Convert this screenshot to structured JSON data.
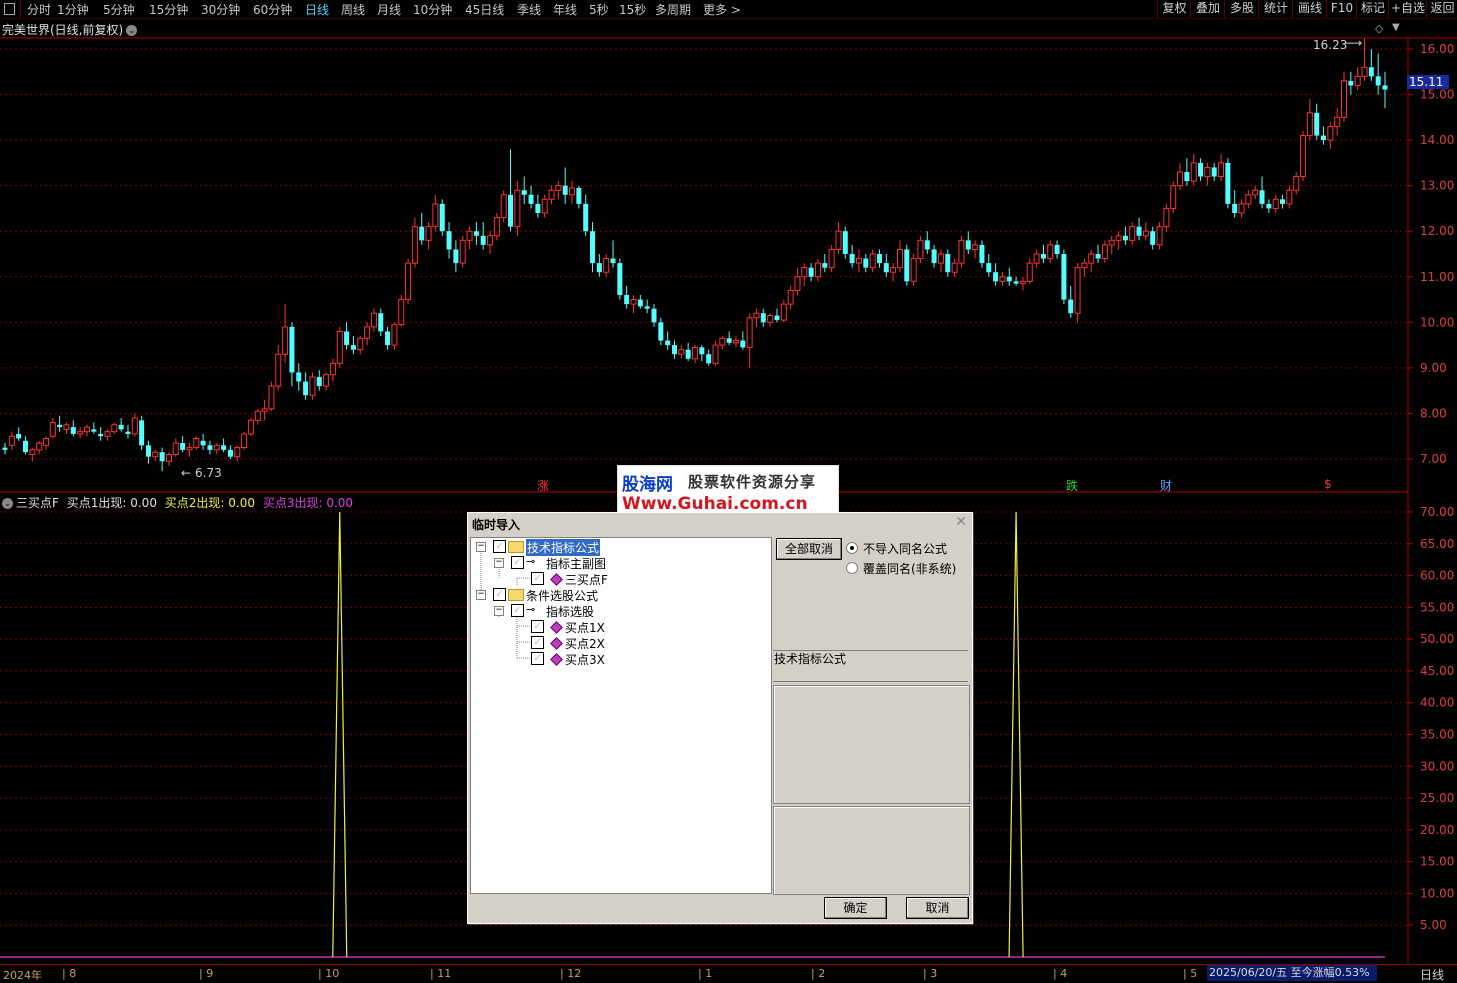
{
  "toolbar": {
    "periods": [
      "分时",
      "1分钟",
      "5分钟",
      "15分钟",
      "30分钟",
      "60分钟",
      "日线",
      "周线",
      "月线",
      "10分钟",
      "45日线",
      "季线",
      "年线",
      "5秒",
      "15秒",
      "多周期",
      "更多 >"
    ],
    "active_period": "日线",
    "right_buttons": [
      "复权",
      "叠加",
      "多股",
      "统计",
      "画线",
      "F10",
      "标记",
      "+自选",
      "返回"
    ]
  },
  "chart_title": "完美世界(日线,前复权)",
  "price_labels": {
    "high": "16.23",
    "low": "6.73",
    "current": "15.11"
  },
  "price_axis": [
    "16.00",
    "15.00",
    "14.00",
    "13.00",
    "12.00",
    "11.00",
    "10.00",
    "9.00",
    "8.00",
    "7.00"
  ],
  "markers": {
    "zhang": "涨",
    "die": "跌",
    "cai": "财",
    "dollar": "$"
  },
  "indicator": {
    "name": "三买点F",
    "b1_label": "买点1出现: ",
    "b1_value": "0.00",
    "b2_label": "买点2出现: ",
    "b2_value": "0.00",
    "b3_label": "买点3出现: ",
    "b3_value": "0.00",
    "axis": [
      "70.00",
      "65.00",
      "60.00",
      "55.00",
      "50.00",
      "45.00",
      "40.00",
      "35.00",
      "30.00",
      "25.00",
      "20.00",
      "15.00",
      "10.00",
      "5.00"
    ]
  },
  "watermark": {
    "name": "股海网",
    "slogan": "股票软件资源分享",
    "url": "Www.Guhai.com.cn"
  },
  "dialog": {
    "title": "临时导入",
    "tree": [
      {
        "label": "技术指标公式"
      },
      {
        "label": "指标主副图"
      },
      {
        "label": "三买点F"
      },
      {
        "label": "条件选股公式"
      },
      {
        "label": "指标选股"
      },
      {
        "label": "买点1X"
      },
      {
        "label": "买点2X"
      },
      {
        "label": "买点3X"
      }
    ],
    "deselect_all": "全部取消",
    "opt_no_import": "不导入同名公式",
    "opt_overwrite": "覆盖同名(非系统)",
    "section_label": "技术指标公式",
    "ok": "确定",
    "cancel": "取消"
  },
  "timeline": {
    "months": [
      "2024年",
      "8",
      "9",
      "10",
      "11",
      "12",
      "1",
      "2",
      "3",
      "4",
      "5"
    ],
    "status": "2025/06/20/五  至今涨幅0.53%",
    "period": "日线"
  },
  "chart_data": {
    "type": "candlestick",
    "ylim": [
      6.5,
      16.5
    ],
    "candles": [
      [
        7.25,
        7.35,
        7.1,
        7.2
      ],
      [
        7.3,
        7.6,
        7.2,
        7.5
      ],
      [
        7.55,
        7.7,
        7.4,
        7.45
      ],
      [
        7.4,
        7.5,
        7.1,
        7.15
      ],
      [
        7.1,
        7.25,
        6.95,
        7.2
      ],
      [
        7.2,
        7.4,
        7.1,
        7.35
      ],
      [
        7.3,
        7.5,
        7.2,
        7.45
      ],
      [
        7.5,
        7.9,
        7.45,
        7.8
      ],
      [
        7.75,
        7.95,
        7.6,
        7.7
      ],
      [
        7.65,
        7.8,
        7.55,
        7.75
      ],
      [
        7.7,
        7.85,
        7.5,
        7.55
      ],
      [
        7.55,
        7.7,
        7.45,
        7.6
      ],
      [
        7.6,
        7.75,
        7.5,
        7.7
      ],
      [
        7.65,
        7.8,
        7.55,
        7.6
      ],
      [
        7.55,
        7.7,
        7.4,
        7.5
      ],
      [
        7.5,
        7.65,
        7.4,
        7.6
      ],
      [
        7.6,
        7.8,
        7.55,
        7.75
      ],
      [
        7.75,
        7.9,
        7.6,
        7.65
      ],
      [
        7.6,
        7.75,
        7.45,
        7.55
      ],
      [
        7.55,
        8.0,
        7.5,
        7.9
      ],
      [
        7.85,
        7.95,
        7.2,
        7.3
      ],
      [
        7.3,
        7.4,
        6.9,
        7.05
      ],
      [
        7.05,
        7.2,
        6.95,
        7.15
      ],
      [
        7.15,
        7.25,
        6.73,
        6.95
      ],
      [
        6.95,
        7.15,
        6.85,
        7.1
      ],
      [
        7.1,
        7.45,
        7.05,
        7.35
      ],
      [
        7.35,
        7.5,
        7.15,
        7.2
      ],
      [
        7.2,
        7.35,
        7.05,
        7.25
      ],
      [
        7.25,
        7.5,
        7.2,
        7.45
      ],
      [
        7.4,
        7.55,
        7.2,
        7.3
      ],
      [
        7.3,
        7.4,
        7.1,
        7.2
      ],
      [
        7.2,
        7.35,
        7.1,
        7.3
      ],
      [
        7.3,
        7.45,
        7.15,
        7.2
      ],
      [
        7.2,
        7.3,
        7.0,
        7.05
      ],
      [
        7.05,
        7.3,
        6.95,
        7.25
      ],
      [
        7.25,
        7.6,
        7.2,
        7.55
      ],
      [
        7.55,
        7.9,
        7.5,
        7.85
      ],
      [
        7.85,
        8.1,
        7.75,
        8.05
      ],
      [
        8.05,
        8.3,
        7.85,
        8.1
      ],
      [
        8.1,
        8.7,
        8.05,
        8.6
      ],
      [
        8.6,
        9.5,
        8.5,
        9.3
      ],
      [
        9.3,
        10.4,
        9.1,
        9.9
      ],
      [
        9.9,
        10.0,
        8.6,
        8.9
      ],
      [
        8.9,
        9.1,
        8.5,
        8.7
      ],
      [
        8.7,
        8.9,
        8.3,
        8.4
      ],
      [
        8.4,
        8.9,
        8.3,
        8.8
      ],
      [
        8.8,
        8.95,
        8.5,
        8.6
      ],
      [
        8.6,
        8.9,
        8.5,
        8.85
      ],
      [
        8.85,
        9.2,
        8.7,
        9.1
      ],
      [
        9.1,
        9.9,
        9.0,
        9.8
      ],
      [
        9.8,
        10.0,
        9.4,
        9.5
      ],
      [
        9.5,
        9.7,
        9.3,
        9.4
      ],
      [
        9.4,
        9.7,
        9.3,
        9.65
      ],
      [
        9.65,
        10.0,
        9.5,
        9.9
      ],
      [
        9.9,
        10.3,
        9.8,
        10.2
      ],
      [
        10.2,
        10.3,
        9.7,
        9.8
      ],
      [
        9.8,
        9.9,
        9.4,
        9.5
      ],
      [
        9.5,
        10.0,
        9.4,
        9.95
      ],
      [
        9.95,
        10.6,
        9.9,
        10.5
      ],
      [
        10.5,
        11.4,
        10.4,
        11.3
      ],
      [
        11.3,
        12.3,
        11.2,
        12.1
      ],
      [
        12.1,
        12.4,
        11.7,
        11.8
      ],
      [
        11.8,
        12.2,
        11.6,
        12.1
      ],
      [
        12.1,
        12.8,
        12.0,
        12.6
      ],
      [
        12.6,
        12.7,
        11.9,
        12.0
      ],
      [
        12.0,
        12.2,
        11.4,
        11.6
      ],
      [
        11.6,
        11.8,
        11.1,
        11.3
      ],
      [
        11.3,
        11.9,
        11.2,
        11.8
      ],
      [
        11.8,
        12.1,
        11.6,
        12.0
      ],
      [
        12.0,
        12.2,
        11.7,
        11.9
      ],
      [
        11.9,
        12.2,
        11.6,
        11.7
      ],
      [
        11.7,
        12.0,
        11.5,
        11.9
      ],
      [
        11.9,
        12.4,
        11.8,
        12.3
      ],
      [
        12.3,
        12.9,
        12.2,
        12.8
      ],
      [
        12.8,
        13.8,
        12.0,
        12.1
      ],
      [
        12.1,
        13.1,
        11.9,
        12.9
      ],
      [
        12.9,
        13.2,
        12.6,
        12.8
      ],
      [
        12.8,
        13.0,
        12.5,
        12.6
      ],
      [
        12.6,
        12.8,
        12.3,
        12.4
      ],
      [
        12.4,
        12.8,
        12.3,
        12.7
      ],
      [
        12.7,
        13.0,
        12.6,
        12.9
      ],
      [
        12.9,
        13.1,
        12.7,
        13.0
      ],
      [
        13.0,
        13.4,
        12.6,
        12.8
      ],
      [
        12.8,
        13.1,
        12.6,
        12.95
      ],
      [
        12.95,
        13.0,
        12.5,
        12.6
      ],
      [
        12.6,
        12.8,
        11.9,
        12.0
      ],
      [
        12.0,
        12.2,
        11.1,
        11.3
      ],
      [
        11.3,
        11.5,
        11.0,
        11.1
      ],
      [
        11.1,
        11.5,
        11.0,
        11.4
      ],
      [
        11.4,
        11.8,
        11.2,
        11.3
      ],
      [
        11.3,
        11.4,
        10.5,
        10.6
      ],
      [
        10.6,
        10.8,
        10.3,
        10.4
      ],
      [
        10.4,
        10.6,
        10.2,
        10.5
      ],
      [
        10.5,
        10.6,
        10.3,
        10.35
      ],
      [
        10.35,
        10.5,
        10.2,
        10.3
      ],
      [
        10.3,
        10.4,
        9.9,
        10.0
      ],
      [
        10.0,
        10.1,
        9.5,
        9.6
      ],
      [
        9.6,
        9.8,
        9.4,
        9.5
      ],
      [
        9.5,
        9.6,
        9.2,
        9.3
      ],
      [
        9.3,
        9.5,
        9.2,
        9.4
      ],
      [
        9.4,
        9.55,
        9.15,
        9.2
      ],
      [
        9.2,
        9.5,
        9.1,
        9.45
      ],
      [
        9.45,
        9.5,
        9.15,
        9.3
      ],
      [
        9.3,
        9.4,
        9.05,
        9.1
      ],
      [
        9.1,
        9.6,
        9.05,
        9.5
      ],
      [
        9.5,
        9.7,
        9.4,
        9.65
      ],
      [
        9.65,
        9.8,
        9.5,
        9.55
      ],
      [
        9.55,
        9.7,
        9.45,
        9.6
      ],
      [
        9.6,
        9.8,
        9.4,
        9.45
      ],
      [
        9.45,
        10.2,
        9.0,
        10.1
      ],
      [
        10.1,
        10.3,
        9.9,
        10.2
      ],
      [
        10.2,
        10.3,
        9.9,
        10.0
      ],
      [
        10.0,
        10.2,
        9.9,
        10.15
      ],
      [
        10.15,
        10.3,
        10.0,
        10.05
      ],
      [
        10.05,
        10.5,
        10.0,
        10.4
      ],
      [
        10.4,
        10.8,
        10.3,
        10.7
      ],
      [
        10.7,
        11.2,
        10.6,
        11.0
      ],
      [
        11.0,
        11.3,
        10.8,
        11.2
      ],
      [
        11.2,
        11.3,
        10.9,
        11.0
      ],
      [
        11.0,
        11.4,
        10.9,
        11.3
      ],
      [
        11.3,
        11.5,
        11.1,
        11.2
      ],
      [
        11.2,
        11.7,
        11.1,
        11.6
      ],
      [
        11.6,
        12.2,
        11.5,
        12.0
      ],
      [
        12.0,
        12.1,
        11.4,
        11.5
      ],
      [
        11.5,
        11.7,
        11.2,
        11.3
      ],
      [
        11.3,
        11.6,
        11.1,
        11.4
      ],
      [
        11.4,
        11.5,
        11.1,
        11.2
      ],
      [
        11.2,
        11.6,
        11.1,
        11.5
      ],
      [
        11.5,
        11.6,
        11.2,
        11.3
      ],
      [
        11.3,
        11.5,
        11.0,
        11.1
      ],
      [
        11.1,
        11.3,
        10.9,
        11.2
      ],
      [
        11.2,
        11.8,
        11.1,
        11.6
      ],
      [
        11.6,
        11.7,
        10.8,
        10.9
      ],
      [
        10.9,
        11.5,
        10.8,
        11.4
      ],
      [
        11.4,
        11.9,
        11.3,
        11.8
      ],
      [
        11.8,
        12.0,
        11.5,
        11.6
      ],
      [
        11.6,
        11.7,
        11.2,
        11.3
      ],
      [
        11.3,
        11.6,
        11.1,
        11.5
      ],
      [
        11.5,
        11.6,
        11.0,
        11.1
      ],
      [
        11.1,
        11.4,
        11.0,
        11.3
      ],
      [
        11.3,
        11.9,
        11.2,
        11.8
      ],
      [
        11.8,
        12.0,
        11.5,
        11.6
      ],
      [
        11.6,
        11.8,
        11.4,
        11.7
      ],
      [
        11.7,
        11.8,
        11.2,
        11.3
      ],
      [
        11.3,
        11.5,
        11.0,
        11.1
      ],
      [
        11.1,
        11.3,
        10.8,
        10.9
      ],
      [
        10.9,
        11.1,
        10.8,
        11.0
      ],
      [
        11.0,
        11.2,
        10.8,
        10.9
      ],
      [
        10.9,
        11.0,
        10.8,
        10.85
      ],
      [
        10.85,
        11.0,
        10.7,
        10.9
      ],
      [
        10.9,
        11.4,
        10.85,
        11.3
      ],
      [
        11.3,
        11.6,
        11.2,
        11.5
      ],
      [
        11.5,
        11.7,
        11.3,
        11.4
      ],
      [
        11.4,
        11.8,
        11.3,
        11.7
      ],
      [
        11.7,
        11.8,
        11.4,
        11.5
      ],
      [
        11.5,
        11.6,
        10.4,
        10.5
      ],
      [
        10.5,
        10.8,
        10.1,
        10.2
      ],
      [
        10.2,
        11.3,
        10.0,
        11.2
      ],
      [
        11.2,
        11.4,
        11.0,
        11.3
      ],
      [
        11.3,
        11.6,
        11.1,
        11.5
      ],
      [
        11.5,
        11.7,
        11.3,
        11.4
      ],
      [
        11.4,
        11.8,
        11.3,
        11.7
      ],
      [
        11.7,
        11.9,
        11.5,
        11.8
      ],
      [
        11.8,
        12.0,
        11.6,
        11.9
      ],
      [
        11.9,
        12.1,
        11.7,
        11.8
      ],
      [
        11.8,
        12.2,
        11.7,
        12.1
      ],
      [
        12.1,
        12.3,
        11.8,
        11.9
      ],
      [
        11.9,
        12.2,
        11.8,
        12.0
      ],
      [
        12.0,
        12.1,
        11.6,
        11.7
      ],
      [
        11.7,
        12.2,
        11.6,
        12.1
      ],
      [
        12.1,
        12.6,
        12.0,
        12.5
      ],
      [
        12.5,
        13.1,
        12.4,
        13.0
      ],
      [
        13.0,
        13.5,
        12.9,
        13.3
      ],
      [
        13.3,
        13.6,
        13.0,
        13.1
      ],
      [
        13.1,
        13.7,
        13.0,
        13.5
      ],
      [
        13.5,
        13.6,
        13.1,
        13.2
      ],
      [
        13.2,
        13.5,
        13.0,
        13.4
      ],
      [
        13.4,
        13.5,
        13.1,
        13.2
      ],
      [
        13.2,
        13.7,
        13.1,
        13.5
      ],
      [
        13.5,
        13.6,
        12.5,
        12.6
      ],
      [
        12.6,
        12.9,
        12.3,
        12.4
      ],
      [
        12.4,
        12.7,
        12.3,
        12.6
      ],
      [
        12.6,
        12.9,
        12.5,
        12.8
      ],
      [
        12.8,
        13.0,
        12.7,
        12.9
      ],
      [
        12.9,
        13.2,
        12.5,
        12.6
      ],
      [
        12.6,
        12.7,
        12.4,
        12.5
      ],
      [
        12.5,
        12.8,
        12.4,
        12.7
      ],
      [
        12.7,
        12.8,
        12.5,
        12.6
      ],
      [
        12.6,
        13.0,
        12.5,
        12.9
      ],
      [
        12.9,
        13.3,
        12.8,
        13.2
      ],
      [
        13.2,
        14.2,
        13.1,
        14.1
      ],
      [
        14.1,
        14.9,
        14.0,
        14.6
      ],
      [
        14.6,
        14.8,
        14.0,
        14.1
      ],
      [
        14.1,
        14.3,
        13.9,
        14.0
      ],
      [
        14.0,
        14.4,
        13.8,
        14.3
      ],
      [
        14.3,
        14.7,
        14.1,
        14.5
      ],
      [
        14.5,
        15.5,
        14.4,
        15.3
      ],
      [
        15.3,
        15.5,
        15.0,
        15.2
      ],
      [
        15.2,
        15.6,
        15.1,
        15.4
      ],
      [
        15.4,
        16.23,
        15.3,
        15.6
      ],
      [
        15.6,
        16.0,
        15.3,
        15.4
      ],
      [
        15.4,
        15.9,
        15.0,
        15.2
      ],
      [
        15.2,
        15.5,
        14.7,
        15.11
      ]
    ],
    "indicator_line": {
      "baseline": 0,
      "spikes": [
        {
          "index": 49,
          "value": 70
        },
        {
          "index": 148,
          "value": 70
        }
      ],
      "ylim": [
        0,
        73
      ]
    }
  }
}
